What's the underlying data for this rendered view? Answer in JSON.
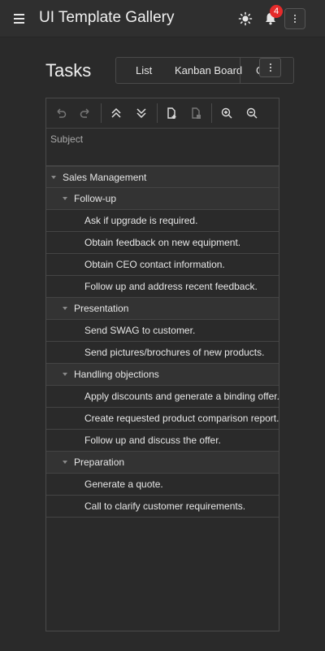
{
  "app": {
    "title": "UI Template Gallery",
    "notification_count": "4",
    "icons": {
      "menu": "hamburger-menu-icon",
      "theme": "sun-icon",
      "notifications": "bell-icon",
      "more": "more-vertical-icon"
    }
  },
  "page": {
    "title": "Tasks",
    "views": [
      "List",
      "Kanban Board",
      "G"
    ]
  },
  "toolbar": {
    "icons": [
      "undo-icon",
      "redo-icon",
      "collapse-all-icon",
      "expand-all-icon",
      "add-row-icon",
      "delete-row-icon",
      "zoom-in-icon",
      "zoom-out-icon"
    ]
  },
  "grid": {
    "column_header": "Subject",
    "rows": [
      {
        "level": 0,
        "group": true,
        "text": "Sales Management"
      },
      {
        "level": 1,
        "group": true,
        "text": "Follow-up"
      },
      {
        "level": 2,
        "group": false,
        "text": "Ask if upgrade is required."
      },
      {
        "level": 2,
        "group": false,
        "text": "Obtain feedback on new equipment."
      },
      {
        "level": 2,
        "group": false,
        "text": "Obtain CEO contact information."
      },
      {
        "level": 2,
        "group": false,
        "text": "Follow up and address recent feedback."
      },
      {
        "level": 1,
        "group": true,
        "text": "Presentation"
      },
      {
        "level": 2,
        "group": false,
        "text": "Send SWAG to customer."
      },
      {
        "level": 2,
        "group": false,
        "text": "Send pictures/brochures of new products."
      },
      {
        "level": 1,
        "group": true,
        "text": "Handling objections"
      },
      {
        "level": 2,
        "group": false,
        "text": "Apply discounts and generate a binding offer."
      },
      {
        "level": 2,
        "group": false,
        "text": "Create requested product comparison report."
      },
      {
        "level": 2,
        "group": false,
        "text": "Follow up and discuss the offer."
      },
      {
        "level": 1,
        "group": true,
        "text": "Preparation"
      },
      {
        "level": 2,
        "group": false,
        "text": "Generate a quote."
      },
      {
        "level": 2,
        "group": false,
        "text": "Call to clarify customer requirements."
      }
    ]
  },
  "colors": {
    "badge": "#e52b2b",
    "background": "#2a2a2a",
    "group_row": "#333333"
  }
}
